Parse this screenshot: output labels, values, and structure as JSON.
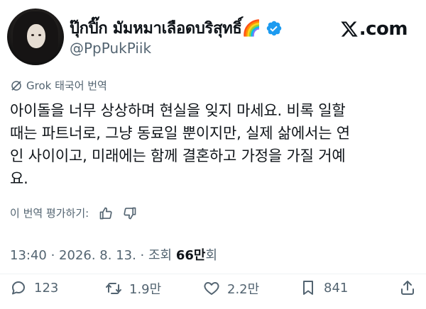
{
  "profile": {
    "display_name": "ปุ๊กปิ๊ก มัมหมาเลือดบริสุทธิ์",
    "display_name_emoji": "🌈",
    "handle": "@PpPukPiik",
    "verified": true,
    "avatar_icon": "avatar-photo"
  },
  "brand": {
    "logo_text": ".com",
    "logo_icon": "x-logo-icon"
  },
  "grok": {
    "label": "Grok 태국어 번역",
    "icon": "grok-icon"
  },
  "tweet": {
    "text": "아이돌을 너무 상상하며 현실을 잊지 마세요. 비록 일할\n때는 파트너로, 그냥 동료일 뿐이지만, 실제 삶에서는 연\n인 사이이고, 미래에는 함께 결혼하고 가정을 가질 거예\n요."
  },
  "rating": {
    "label": "이 번역 평가하기:",
    "icons": [
      "thumbs-up-icon",
      "thumbs-down-icon"
    ]
  },
  "meta": {
    "time": "13:40",
    "sep1": " · ",
    "date": "2026. 8. 13.",
    "sep2": " · ",
    "views_prefix": "조회 ",
    "views_count": "66만",
    "views_suffix": "회"
  },
  "actions": {
    "reply_count": "123",
    "repost_count": "1.9만",
    "like_count": "2.2만",
    "bookmark_count": "841"
  },
  "colors": {
    "text": "#0f1419",
    "secondary": "#536471",
    "verified_blue": "#1d9bf0"
  }
}
